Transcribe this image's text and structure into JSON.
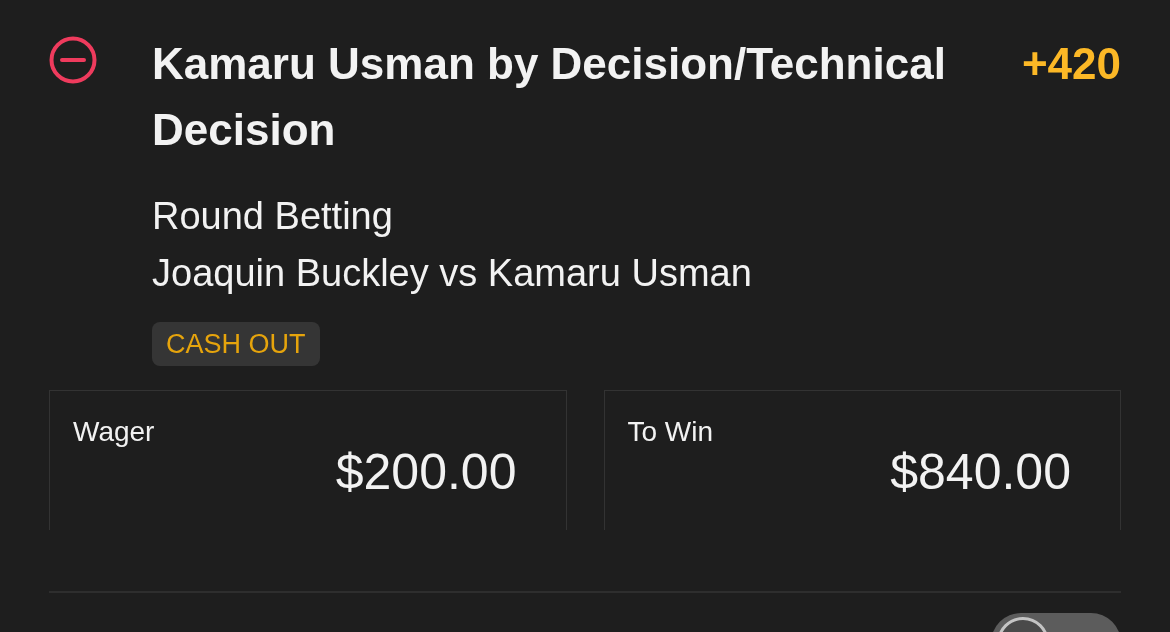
{
  "selection": {
    "title": "Kamaru Usman by Decision/Technical Decision",
    "odds": "+420",
    "market": "Round Betting",
    "event": "Joaquin Buckley vs Kamaru Usman",
    "cash_out": "CASH OUT"
  },
  "amounts": [
    {
      "label": "Wager",
      "value": "$200.00"
    },
    {
      "label": "To Win",
      "value": "$840.00"
    }
  ],
  "toggle": {
    "on": false
  }
}
